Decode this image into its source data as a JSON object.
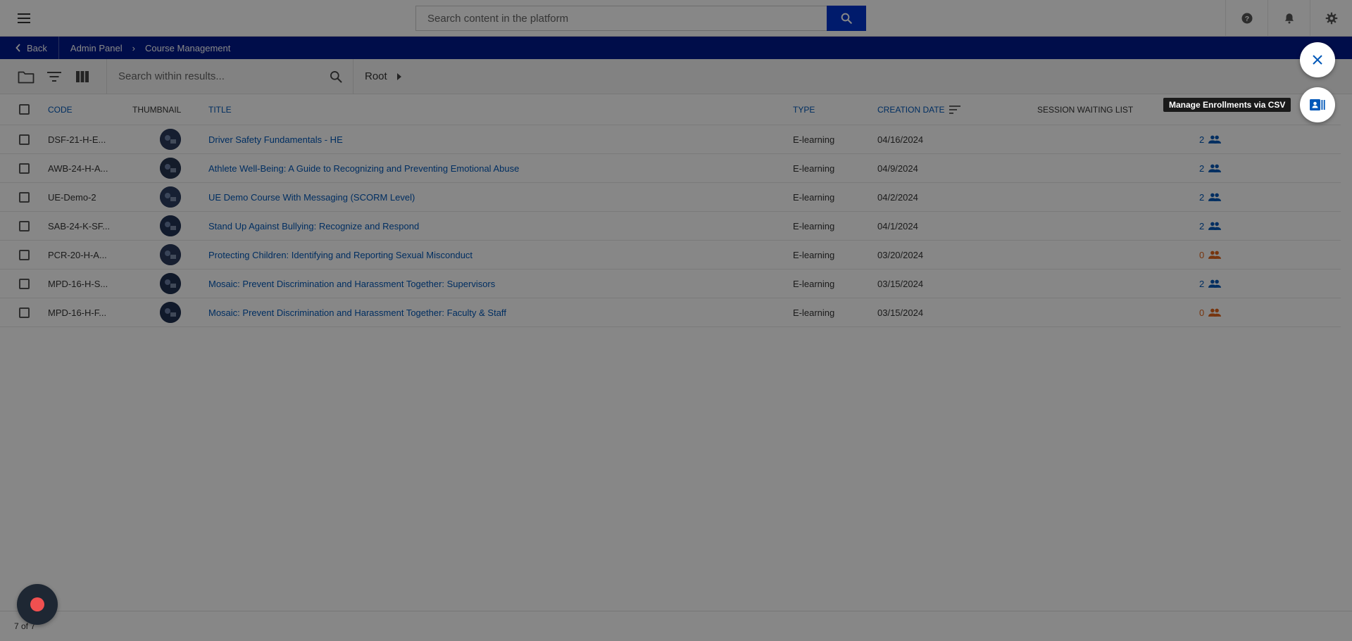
{
  "header": {
    "search_placeholder": "Search content in the platform",
    "icons": [
      "menu-icon",
      "search-icon",
      "help-icon",
      "bell-icon",
      "gear-icon"
    ]
  },
  "breadcrumb": {
    "back_label": "Back",
    "items": [
      "Admin Panel",
      "Course Management"
    ],
    "separator": "›"
  },
  "toolbar": {
    "search_placeholder": "Search within results...",
    "root_label": "Root"
  },
  "table": {
    "columns": {
      "code": "CODE",
      "thumbnail": "THUMBNAIL",
      "title": "TITLE",
      "type": "TYPE",
      "creation_date": "CREATION DATE",
      "session_waiting_list": "SESSION WAITING LIST"
    },
    "rows": [
      {
        "code": "DSF-21-H-E...",
        "title": "Driver Safety Fundamentals - HE",
        "type": "E-learning",
        "date": "04/16/2024",
        "enrollments": "2",
        "status": "blue"
      },
      {
        "code": "AWB-24-H-A...",
        "title": "Athlete Well-Being: A Guide to Recognizing and Preventing Emotional Abuse",
        "type": "E-learning",
        "date": "04/9/2024",
        "enrollments": "2",
        "status": "blue"
      },
      {
        "code": "UE-Demo-2",
        "title": "UE Demo Course With Messaging (SCORM Level)",
        "type": "E-learning",
        "date": "04/2/2024",
        "enrollments": "2",
        "status": "blue"
      },
      {
        "code": "SAB-24-K-SF...",
        "title": "Stand Up Against Bullying: Recognize and Respond",
        "type": "E-learning",
        "date": "04/1/2024",
        "enrollments": "2",
        "status": "blue"
      },
      {
        "code": "PCR-20-H-A...",
        "title": "Protecting Children: Identifying and Reporting Sexual Misconduct",
        "type": "E-learning",
        "date": "03/20/2024",
        "enrollments": "0",
        "status": "orange"
      },
      {
        "code": "MPD-16-H-S...",
        "title": "Mosaic: Prevent Discrimination and Harassment Together: Supervisors",
        "type": "E-learning",
        "date": "03/15/2024",
        "enrollments": "2",
        "status": "blue"
      },
      {
        "code": "MPD-16-H-F...",
        "title": "Mosaic: Prevent Discrimination and Harassment Together: Faculty & Staff",
        "type": "E-learning",
        "date": "03/15/2024",
        "enrollments": "0",
        "status": "orange"
      }
    ]
  },
  "footer": {
    "count": "7 of 7"
  },
  "fab": {
    "tooltip": "Manage Enrollments via CSV"
  },
  "colors": {
    "primary": "#0033cc",
    "breadcrumb_bg": "#001a8c",
    "link": "#0057b8",
    "warning": "#e0641c",
    "record": "#f05050"
  }
}
